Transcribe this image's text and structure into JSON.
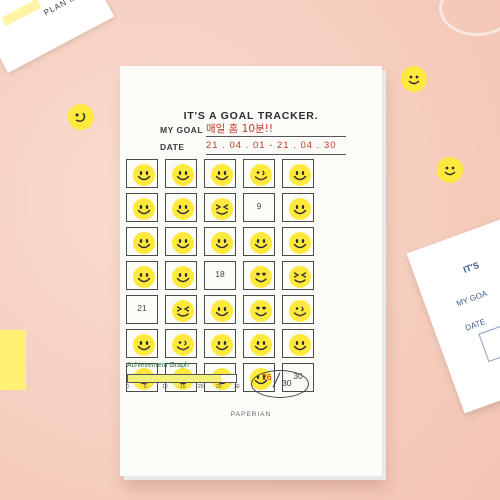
{
  "background": {
    "color": "#f7d2c4"
  },
  "corner_paper": {
    "text": "PLAN MA"
  },
  "right_paper": {
    "title": "IT'S",
    "goal_label": "MY GOA",
    "date_label": "DATE"
  },
  "tracker": {
    "title": "IT'S A GOAL TRACKER.",
    "goal_label": "MY GOAL",
    "goal_text": "매일 홈 10분!!",
    "date_label": "DATE",
    "date_text": "21 . 04 . 01 - 21 . 04 . 30",
    "cells": [
      "smiley-happy",
      "smiley-happy",
      "smiley-happy",
      "smiley-tongue",
      "smiley-happy",
      "smiley-happy",
      "smiley-happy",
      "smiley-squint",
      "9",
      "smiley-happy",
      "smiley-happy",
      "smiley-happy",
      "smiley-happy",
      "smiley-happy",
      "smiley-happy",
      "smiley-happy",
      "smiley-happy",
      "18",
      "smiley-hearts",
      "smiley-squint",
      "21",
      "smiley-squint",
      "smiley-happy",
      "smiley-hearts",
      "smiley-tongue",
      "smiley-happy",
      "smiley-tongue",
      "smiley-happy",
      "smiley-happy",
      "smiley-happy",
      "smiley-tongue",
      "smiley-happy",
      "smiley-happy",
      "smiley-happy",
      "30"
    ],
    "achievement": {
      "label": "Achievement Graph",
      "progress_days": 26,
      "max_days": 30,
      "ticks": [
        "0",
        "5",
        "10",
        "15",
        "20",
        "25",
        "30"
      ]
    },
    "score": {
      "got": "26",
      "total": "30"
    },
    "brand": "PAPERIAN"
  },
  "colors": {
    "sticker_yellow": "#ffe93d",
    "ink_red": "#c0392b",
    "face_ink": "#2b2b2b"
  }
}
